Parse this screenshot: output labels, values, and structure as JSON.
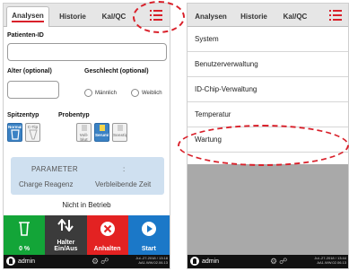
{
  "left": {
    "tabs": [
      {
        "label": "Analysen",
        "active": true
      },
      {
        "label": "Historie",
        "active": false
      },
      {
        "label": "Kal/QC",
        "active": false
      }
    ],
    "patient_id_label": "Patienten-ID",
    "patient_id_value": "",
    "age_label": "Alter (optional)",
    "age_value": "",
    "gender_label": "Geschlecht (optional)",
    "gender_options": [
      "Männlich",
      "Weiblich"
    ],
    "tip_type_label": "Spitzentyp",
    "tip_types": [
      {
        "label": "Normal",
        "selected": true
      },
      {
        "label": "C-Tip",
        "selected": false
      }
    ],
    "sample_type_label": "Probentyp",
    "sample_types": [
      {
        "label": "Voll-blut",
        "selected": false
      },
      {
        "label": "Serum/Plasma",
        "selected": true
      },
      {
        "label": "Sonstige",
        "selected": false
      }
    ],
    "param_header": "PARAMETER",
    "param_colon": ":",
    "param_charge": "Charge Reagenz",
    "param_remaining": "Verbleibende Zeit",
    "status_text": "Nicht in Betrieb",
    "actions": [
      {
        "label": "0 %",
        "color": "#13a538",
        "icon": "waste-bin-icon"
      },
      {
        "label": "Halter Ein/Aus",
        "color": "#3b3b3b",
        "icon": "up-down-arrows-icon"
      },
      {
        "label": "Anhalten",
        "color": "#e32222",
        "icon": "stop-x-icon"
      },
      {
        "label": "Start",
        "color": "#1b78c8",
        "icon": "play-icon"
      }
    ],
    "footer": {
      "user": "admin",
      "date": "Jul.-27-2018 / 13:18",
      "version": "AA1.WW.02.06.13"
    }
  },
  "right": {
    "tabs": [
      {
        "label": "Analysen"
      },
      {
        "label": "Historie"
      },
      {
        "label": "Kal/QC"
      }
    ],
    "menu_items": [
      "System",
      "Benutzerverwaltung",
      "ID-Chip-Verwaltung",
      "Temperatur",
      "Wartung"
    ],
    "footer": {
      "user": "admin",
      "date": "Jul.-27-2018 / 13:44",
      "version": "AA1.WW.02.06.13"
    }
  },
  "colors": {
    "accent": "#d9202a",
    "selected_blue": "#3b82c4",
    "param_box": "#cfe0f0"
  }
}
